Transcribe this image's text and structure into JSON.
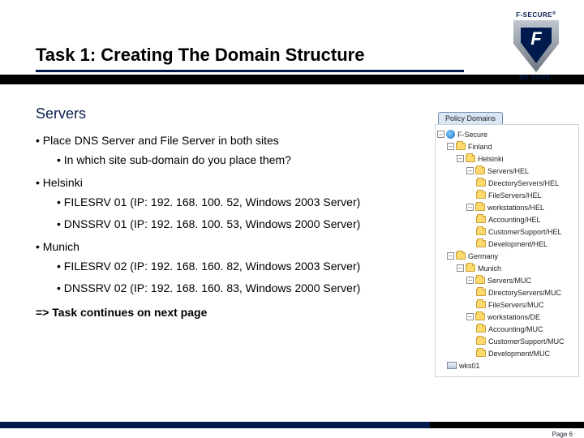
{
  "logo": {
    "brand": "F-SECURE",
    "tagline": "BE SURE."
  },
  "title": "Task 1: Creating The Domain Structure",
  "heading": "Servers",
  "bullets": {
    "b1": "Place DNS Server and File Server in both sites",
    "b1a": "In which site sub-domain do you place them?",
    "b2": "Helsinki",
    "b2a": "FILESRV 01 (IP: 192. 168. 100. 52, Windows 2003 Server)",
    "b2b": "DNSSRV 01 (IP: 192. 168. 100. 53, Windows 2000 Server)",
    "b3": "Munich",
    "b3a": "FILESRV 02 (IP: 192. 168. 160. 82, Windows 2003 Server)",
    "b3b": "DNSSRV 02 (IP: 192. 168. 160. 83, Windows 2000 Server)"
  },
  "continues": "=> Task continues on next page",
  "tree": {
    "tab": "Policy Domains",
    "nodes": {
      "root": "F-Secure",
      "fin": "Finland",
      "hel": "Helsinki",
      "srvhel": "Servers/HEL",
      "dirhel": "DirectoryServers/HEL",
      "filehel": "FileServers/HEL",
      "wkshel": "workstations/HEL",
      "acchel": "Accounting/HEL",
      "cshel": "CustomerSupport/HEL",
      "devhel": "Development/HEL",
      "ger": "Germany",
      "muc": "Munich",
      "srvmuc": "Servers/MUC",
      "dirmuc": "DirectoryServers/MUC",
      "filemuc": "FileServers/MUC",
      "wksmuc": "workstations/DE",
      "accmuc": "Accounting/MUC",
      "csmuc": "CustomerSupport/MUC",
      "devmuc": "Development/MUC",
      "wks01": "wks01"
    }
  },
  "footer": {
    "page": "Page 6"
  }
}
